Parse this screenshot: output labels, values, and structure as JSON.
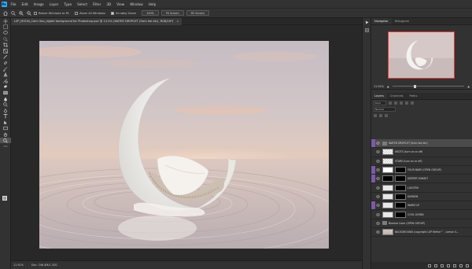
{
  "menubar": {
    "logo": "Ps",
    "items": [
      "File",
      "Edit",
      "Image",
      "Layer",
      "Type",
      "Select",
      "Filter",
      "3D",
      "View",
      "Window",
      "Help"
    ]
  },
  "options": {
    "resize_windows": "Resize Windows to Fit",
    "zoom_all": "Zoom All Windows",
    "scrubby_zoom": "Scrubby Zoom",
    "btn_100": "100%",
    "btn_fit": "Fit Screen",
    "btn_fill": "Fill Screen"
  },
  "document": {
    "tab_title": "LSP_MOON_Calm Sea_digital background for Photoshop.psd @ 13.3% (WATER DROPLET (from lee etc), RGB/16*)",
    "close_glyph": "×"
  },
  "status": {
    "zoom": "11.92%",
    "doc_size": "Doc: 246.4M/1.32G"
  },
  "panels": {
    "top_tabs": [
      "Navigator",
      "Histogram"
    ],
    "nav_zoom": "11.92%",
    "layer_tabs": [
      "Layers",
      "Channels",
      "Paths"
    ],
    "kind_label": "Kind",
    "normal_label": "Normal",
    "layers": [
      {
        "name": "WATER DROPLET (from lee etc)",
        "type": "group",
        "stripe": "#7b5aa6",
        "selected": true
      },
      {
        "name": "HEDTS (turn on or off)",
        "type": "checker",
        "stripe": "#323232"
      },
      {
        "name": "STARS (turn on or off)",
        "type": "checker",
        "stripe": "#323232"
      },
      {
        "name": "YOUR BABY (OPEN GROUP)",
        "type": "white",
        "stripe": "#7b5aa6"
      },
      {
        "name": "DEEPER SUNSET",
        "type": "black",
        "stripe": "#7b5aa6"
      },
      {
        "name": "LIGHTEN",
        "type": "adj",
        "stripe": "#323232"
      },
      {
        "name": "DARKEN",
        "type": "adj",
        "stripe": "#323232"
      },
      {
        "name": "WARM UP",
        "type": "adj",
        "stripe": "#7b5aa6"
      },
      {
        "name": "COOL DOWN",
        "type": "adj",
        "stripe": "#323232"
      },
      {
        "name": "Blanket Color (OPEN GROUP)",
        "type": "group",
        "stripe": "#323232"
      },
      {
        "name": "BACKGROUND (copyright LSP Refine™ - Lemon S...",
        "type": "photo",
        "stripe": "#323232"
      }
    ]
  },
  "colors": {
    "accent": "#31a8ff",
    "selection_purple": "#7b5aa6",
    "nav_frame": "#e03a3a"
  }
}
